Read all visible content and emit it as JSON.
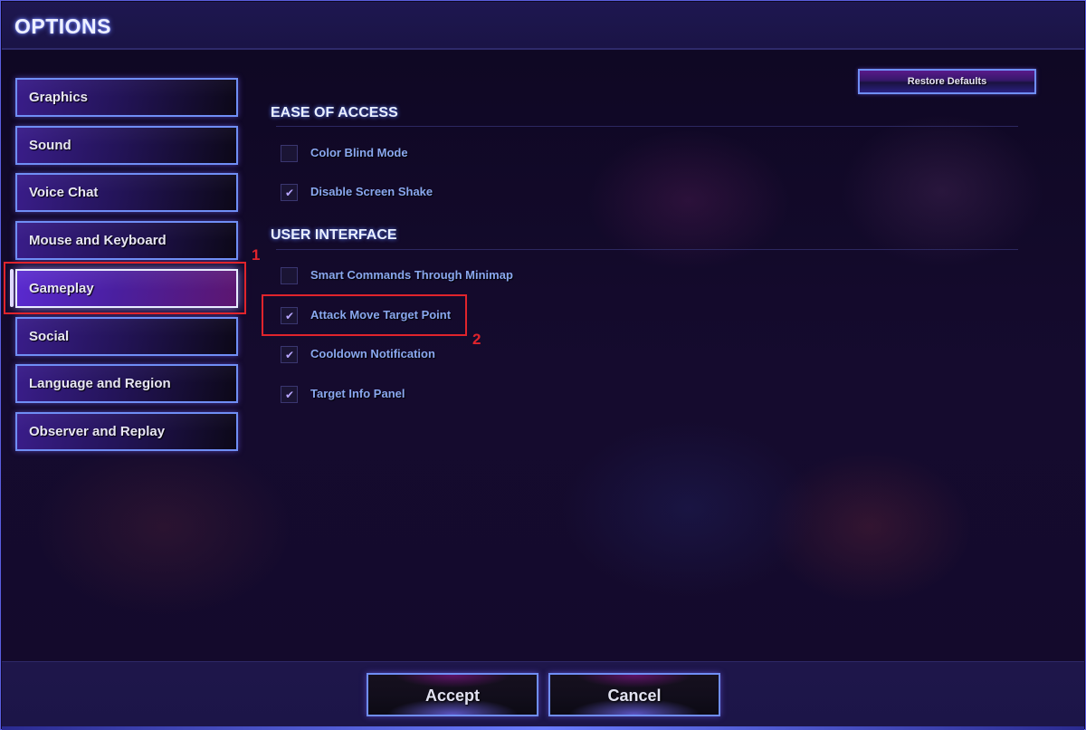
{
  "window": {
    "title": "OPTIONS"
  },
  "sidebar": {
    "items": [
      {
        "label": "Graphics",
        "active": false
      },
      {
        "label": "Sound",
        "active": false
      },
      {
        "label": "Voice Chat",
        "active": false
      },
      {
        "label": "Mouse and Keyboard",
        "active": false
      },
      {
        "label": "Gameplay",
        "active": true
      },
      {
        "label": "Social",
        "active": false
      },
      {
        "label": "Language and Region",
        "active": false
      },
      {
        "label": "Observer and Replay",
        "active": false
      }
    ]
  },
  "toolbar": {
    "restore_defaults_label": "Restore Defaults"
  },
  "sections": [
    {
      "title": "EASE OF ACCESS",
      "options": [
        {
          "label": "Color Blind Mode",
          "checked": false
        },
        {
          "label": "Disable Screen Shake",
          "checked": true
        }
      ]
    },
    {
      "title": "USER INTERFACE",
      "options": [
        {
          "label": "Smart Commands Through Minimap",
          "checked": false
        },
        {
          "label": "Attack Move Target Point",
          "checked": true
        },
        {
          "label": "Cooldown Notification",
          "checked": true
        },
        {
          "label": "Target Info Panel",
          "checked": true
        }
      ]
    }
  ],
  "icons": {
    "check": "✔"
  },
  "annotations": [
    {
      "number": "1",
      "target": "Gameplay"
    },
    {
      "number": "2",
      "target": "Attack Move Target Point"
    }
  ],
  "footer": {
    "accept_label": "Accept",
    "cancel_label": "Cancel"
  }
}
